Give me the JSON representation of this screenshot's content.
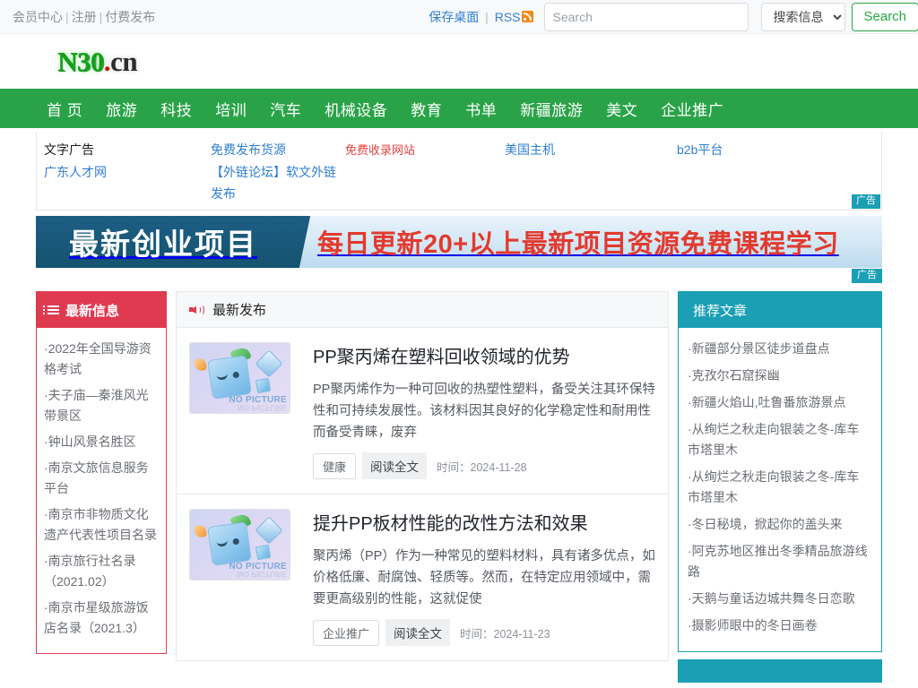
{
  "topbar": {
    "links": [
      "会员中心",
      "注册",
      "付费发布"
    ],
    "save_desktop": "保存桌面",
    "rss": "RSS",
    "rss_icon": "rss-icon",
    "search_placeholder": "Search",
    "search_value": "",
    "search_scope": "搜索信息",
    "search_scope_options": [
      "搜索信息"
    ],
    "search_button": "Search"
  },
  "logo": {
    "green": "N30",
    "dot": ".",
    "black": "cn"
  },
  "nav": {
    "items": [
      "首 页",
      "旅游",
      "科技",
      "培训",
      "汽车",
      "机械设备",
      "教育",
      "书单",
      "新疆旅游",
      "美文",
      "企业推广"
    ]
  },
  "textads": {
    "row1": [
      {
        "label": "文字广告",
        "color": "#1b1b1b"
      },
      {
        "label": "免费发布货源",
        "color": "#2f7fd4"
      },
      {
        "label": "免费收录网站",
        "color": "#e8423f"
      },
      {
        "label": "美国主机",
        "color": "#2f7fd4"
      },
      {
        "label": "b2b平台",
        "color": "#2f7fd4"
      }
    ],
    "row2": [
      {
        "label": "广东人才网",
        "color": "#2f7fd4"
      },
      {
        "label": "【外链论坛】软文外链发布",
        "color": "#2f7fd4"
      },
      {
        "label": "",
        "color": "#2f7fd4"
      },
      {
        "label": "",
        "color": "#2f7fd4"
      },
      {
        "label": "",
        "color": "#2f7fd4"
      }
    ],
    "badge": "广告"
  },
  "banner": {
    "left_text": "最新创业项目",
    "right_text": "每日更新20+以上最新项目资源免费课程学习",
    "badge": "广告",
    "badge2": "广告"
  },
  "left_panel": {
    "title": "最新信息",
    "icon": "list-icon",
    "items": [
      "·2022年全国导游资格考试",
      "·夫子庙—秦淮风光带景区",
      "·钟山风景名胜区",
      "·南京文旅信息服务平台",
      "·南京市非物质文化遗产代表性项目名录",
      "·南京旅行社名录（2021.02）",
      "·南京市星级旅游饭店名录（2021.3）"
    ]
  },
  "middle": {
    "title": "最新发布",
    "icon": "speaker-icon",
    "thumb_alt": "NO PICTURE",
    "articles": [
      {
        "title": "PP聚丙烯在塑料回收领域的优势",
        "desc": "PP聚丙烯作为一种可回收的热塑性塑料，备受关注其环保特性和可持续发展性。该材料因其良好的化学稳定性和耐用性而备受青睐，废弃",
        "tag": "健康",
        "readmore": "阅读全文",
        "time": "时间：2024-11-28"
      },
      {
        "title": "提升PP板材性能的改性方法和效果",
        "desc": "聚丙烯（PP）作为一种常见的塑料材料，具有诸多优点，如价格低廉、耐腐蚀、轻质等。然而，在特定应用领域中，需要更高级别的性能，这就促使",
        "tag": "企业推广",
        "readmore": "阅读全文",
        "time": "时间：2024-11-23"
      }
    ]
  },
  "right_panel": {
    "title": "推荐文章",
    "items": [
      "·新疆部分景区徒步道盘点",
      "·克孜尔石窟探幽",
      "·新疆火焰山,吐鲁番旅游景点",
      "·从绚烂之秋走向银装之冬-库车市塔里木",
      "·从绚烂之秋走向银装之冬-库车市塔里木",
      "·冬日秘境，掀起你的盖头来",
      "·阿克苏地区推出冬季精品旅游线路",
      "·天鹅与童话边城共舞冬日恋歌",
      "·摄影师眼中的冬日画卷"
    ]
  },
  "colors": {
    "nav_green": "#2aa348",
    "accent_red": "#e03a50",
    "accent_teal": "#1b9fb5",
    "link_blue": "#2f7fd4",
    "button_green": "#28a745"
  }
}
